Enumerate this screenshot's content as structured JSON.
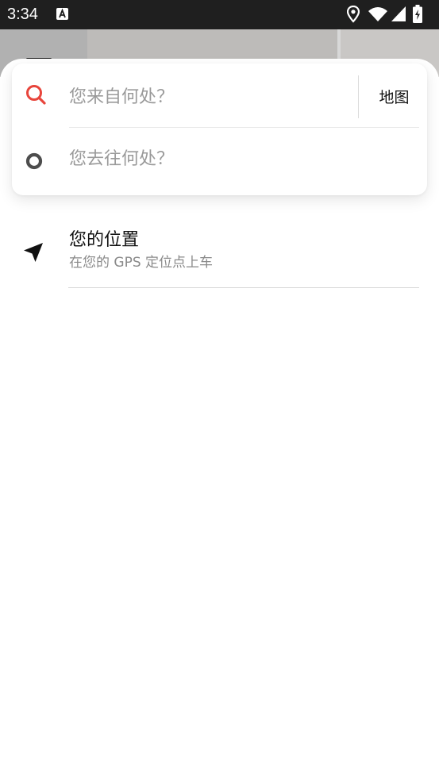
{
  "status_bar": {
    "time": "3:34",
    "icons": [
      "accessibility-a-icon",
      "location-pin-icon",
      "wifi-icon",
      "signal-icon",
      "battery-charging-icon"
    ]
  },
  "search": {
    "from_placeholder": "您来自何处？",
    "to_placeholder": "您去往何处？",
    "map_label": "地图",
    "from_icon": "search-icon",
    "to_icon": "destination-ring-icon"
  },
  "suggestions": {
    "items": [
      {
        "icon": "navigation-arrow-icon",
        "title": "您的位置",
        "subtitle": "在您的 GPS 定位点上车"
      }
    ]
  },
  "colors": {
    "accent": "#e8453c",
    "status_bar": "#1f1f1f",
    "ring": "#4d4d4d"
  }
}
